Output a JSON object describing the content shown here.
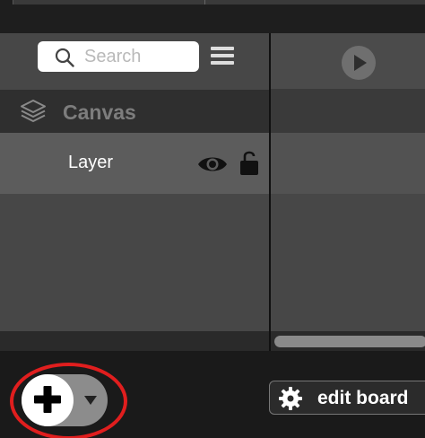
{
  "search": {
    "placeholder": "Search"
  },
  "layers_panel": {
    "group": {
      "label": "Canvas",
      "icon": "layers-icon"
    },
    "items": [
      {
        "label": "Layer",
        "visible": true,
        "locked": false
      }
    ]
  },
  "bottom_bar": {
    "add_button_icon": "plus-icon",
    "add_dropdown_icon": "caret-down-icon",
    "edit_board_label": "edit board",
    "edit_board_icon": "gear-icon"
  },
  "timeline": {
    "play_icon": "play-icon"
  },
  "colors": {
    "panel_bg": "#474747",
    "selected_row": "#5c5c5c",
    "canvas_row": "#2f2f2f",
    "bottom_bg": "#1a1a1a",
    "highlight_ring": "#e01e1e"
  }
}
